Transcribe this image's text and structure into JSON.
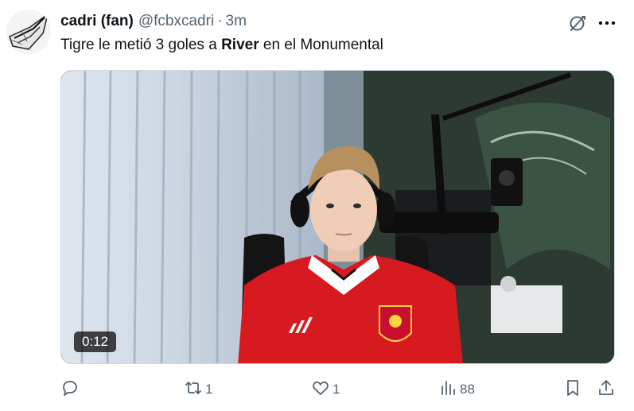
{
  "tweet": {
    "display_name": "cadri (fan)",
    "handle": "@fcbxcadri",
    "separator": "·",
    "time": "3m",
    "text_before": "Tigre le metió 3 goles a ",
    "text_bold": "River",
    "text_after": " en el Monumental"
  },
  "video": {
    "duration": "0:12",
    "jersey_sponsor": "adidas"
  },
  "actions": {
    "reply_count": "",
    "retweet_count": "1",
    "like_count": "1",
    "views_count": "88"
  },
  "icons": [
    "grok-icon",
    "more-icon",
    "reply-icon",
    "retweet-icon",
    "like-icon",
    "views-icon",
    "bookmark-icon",
    "share-icon"
  ],
  "colors": {
    "text_primary": "#0f1419",
    "text_secondary": "#536471",
    "jersey_red": "#d71920"
  }
}
